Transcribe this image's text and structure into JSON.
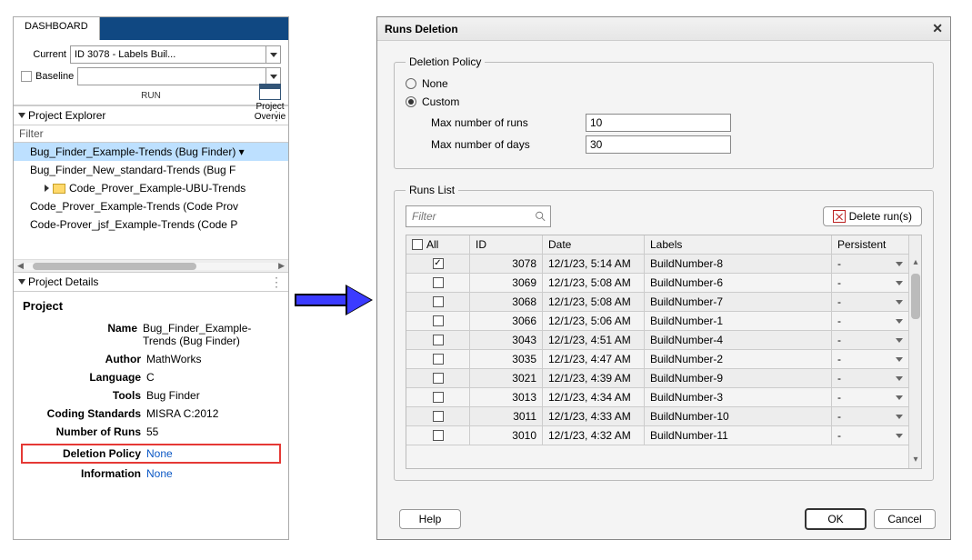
{
  "dashboard": {
    "tab": "DASHBOARD",
    "current_label": "Current",
    "current_value": "ID 3078 - Labels Buil...",
    "baseline_label": "Baseline",
    "baseline_value": "",
    "run_group": "RUN",
    "tool_overview": "Project Overvie"
  },
  "explorer": {
    "title": "Project Explorer",
    "filter": "Filter",
    "items": [
      {
        "label": "Bug_Finder_Example-Trends (Bug Finder)",
        "selected": true
      },
      {
        "label": "Bug_Finder_New_standard-Trends (Bug F"
      },
      {
        "label": "Code_Prover_Example-UBU-Trends",
        "folder": true,
        "expandable": true
      },
      {
        "label": "Code_Prover_Example-Trends (Code Prov"
      },
      {
        "label": "Code-Prover_jsf_Example-Trends (Code P"
      }
    ]
  },
  "details": {
    "section": "Project Details",
    "heading": "Project",
    "fields": {
      "name_k": "Name",
      "name_v": "Bug_Finder_Example-Trends (Bug Finder)",
      "author_k": "Author",
      "author_v": "MathWorks",
      "lang_k": "Language",
      "lang_v": "C",
      "tools_k": "Tools",
      "tools_v": "Bug Finder",
      "cs_k": "Coding Standards",
      "cs_v": "MISRA C:2012",
      "nr_k": "Number of Runs",
      "nr_v": "55",
      "dp_k": "Deletion Policy",
      "dp_v": "None",
      "info_k": "Information",
      "info_v": "None"
    }
  },
  "dialog": {
    "title": "Runs Deletion",
    "policy": {
      "legend": "Deletion Policy",
      "none": "None",
      "custom": "Custom",
      "max_runs_label": "Max number of runs",
      "max_runs_value": "10",
      "max_days_label": "Max number of days",
      "max_days_value": "30"
    },
    "runs": {
      "legend": "Runs List",
      "filter_placeholder": "Filter",
      "delete_btn": "Delete run(s)",
      "headers": {
        "all": "All",
        "id": "ID",
        "date": "Date",
        "labels": "Labels",
        "persistent": "Persistent"
      },
      "rows": [
        {
          "checked": true,
          "id": "3078",
          "date": "12/1/23, 5:14 AM",
          "label": "BuildNumber-8",
          "persistent": "-"
        },
        {
          "checked": false,
          "id": "3069",
          "date": "12/1/23, 5:08 AM",
          "label": "BuildNumber-6",
          "persistent": "-"
        },
        {
          "checked": false,
          "id": "3068",
          "date": "12/1/23, 5:08 AM",
          "label": "BuildNumber-7",
          "persistent": "-"
        },
        {
          "checked": false,
          "id": "3066",
          "date": "12/1/23, 5:06 AM",
          "label": "BuildNumber-1",
          "persistent": "-"
        },
        {
          "checked": false,
          "id": "3043",
          "date": "12/1/23, 4:51 AM",
          "label": "BuildNumber-4",
          "persistent": "-"
        },
        {
          "checked": false,
          "id": "3035",
          "date": "12/1/23, 4:47 AM",
          "label": "BuildNumber-2",
          "persistent": "-"
        },
        {
          "checked": false,
          "id": "3021",
          "date": "12/1/23, 4:39 AM",
          "label": "BuildNumber-9",
          "persistent": "-"
        },
        {
          "checked": false,
          "id": "3013",
          "date": "12/1/23, 4:34 AM",
          "label": "BuildNumber-3",
          "persistent": "-"
        },
        {
          "checked": false,
          "id": "3011",
          "date": "12/1/23, 4:33 AM",
          "label": "BuildNumber-10",
          "persistent": "-"
        },
        {
          "checked": false,
          "id": "3010",
          "date": "12/1/23, 4:32 AM",
          "label": "BuildNumber-11",
          "persistent": "-"
        }
      ]
    },
    "buttons": {
      "help": "Help",
      "ok": "OK",
      "cancel": "Cancel"
    }
  }
}
